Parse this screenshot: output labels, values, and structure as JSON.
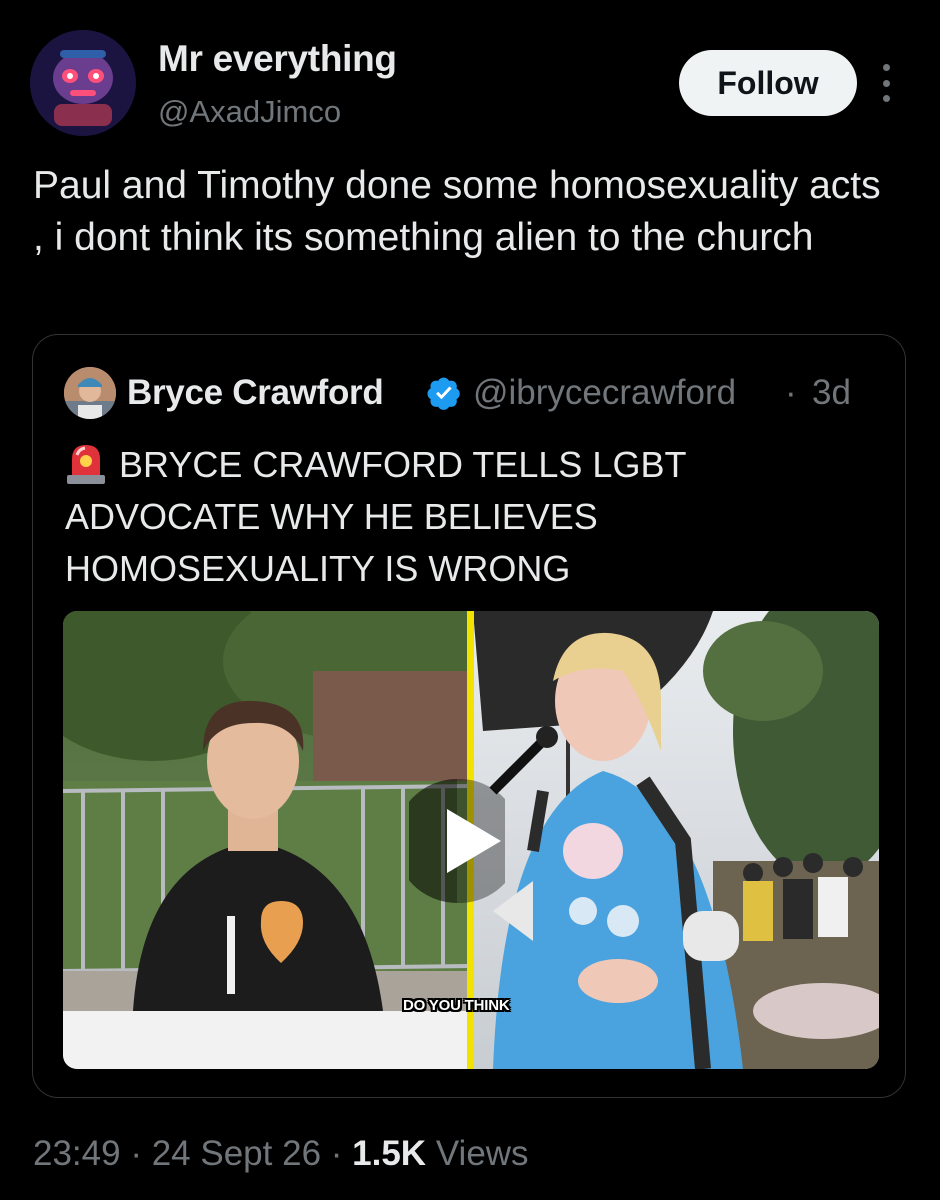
{
  "author": {
    "display_name": "Mr everything",
    "handle": "@AxadJimco",
    "avatar_icon": "robot-avatar"
  },
  "actions": {
    "follow_label": "Follow",
    "more_icon": "more-vertical-icon"
  },
  "tweet": {
    "text": "Paul and Timothy done some homosexuality acts , i dont think its something alien to the church"
  },
  "quoted": {
    "display_name": "Bryce Crawford",
    "handle": "@ibrycecrawford",
    "separator": "·",
    "time": "3d",
    "verified": true,
    "verified_color": "#1d9bf0",
    "lead_icon": "siren-icon",
    "text": "BRYCE CRAWFORD TELLS LGBT ADVOCATE WHY HE BELIEVES HOMOSEXUALITY IS WRONG",
    "media": {
      "type": "video",
      "caption": "DO YOU THINK",
      "divider_color": "#f2e200"
    }
  },
  "meta": {
    "time": "23:49",
    "sep1": "·",
    "date": "24 Sept 26",
    "sep2": "·",
    "views_count": "1.5K",
    "views_label": "Views"
  }
}
